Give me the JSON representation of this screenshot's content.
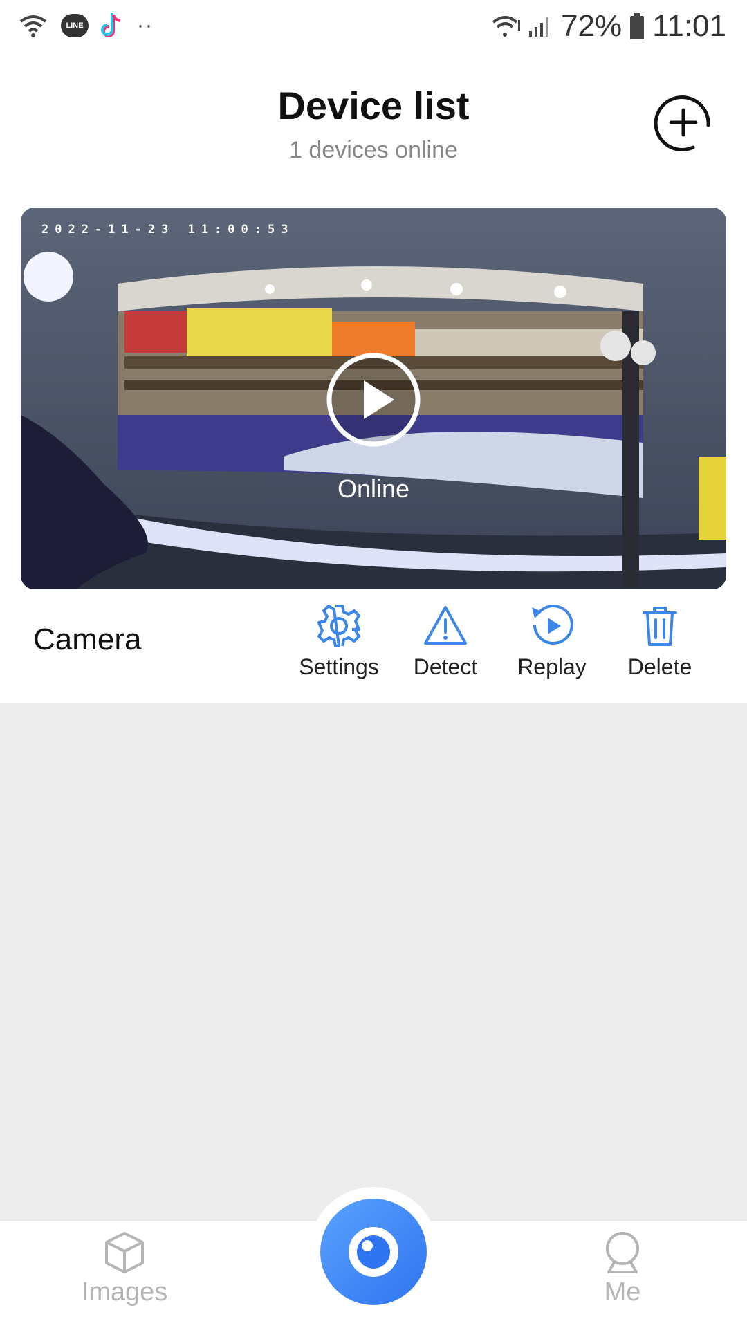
{
  "status_bar": {
    "line_badge": "LINE",
    "dots": "··",
    "battery": "72%",
    "time": "11:01"
  },
  "header": {
    "title": "Device list",
    "subtitle": "1 devices online"
  },
  "device": {
    "timestamp": "2022-11-23 11:00:53",
    "status": "Online",
    "name": "Camera",
    "actions": [
      {
        "label": "Settings",
        "icon": "gear-icon"
      },
      {
        "label": "Detect",
        "icon": "warning-icon"
      },
      {
        "label": "Replay",
        "icon": "replay-icon"
      },
      {
        "label": "Delete",
        "icon": "trash-icon"
      }
    ]
  },
  "nav": {
    "images_label": "Images",
    "me_label": "Me"
  },
  "colors": {
    "accent": "#2f74f0",
    "icon_blue": "#3b86e6",
    "background": "#ededed"
  }
}
